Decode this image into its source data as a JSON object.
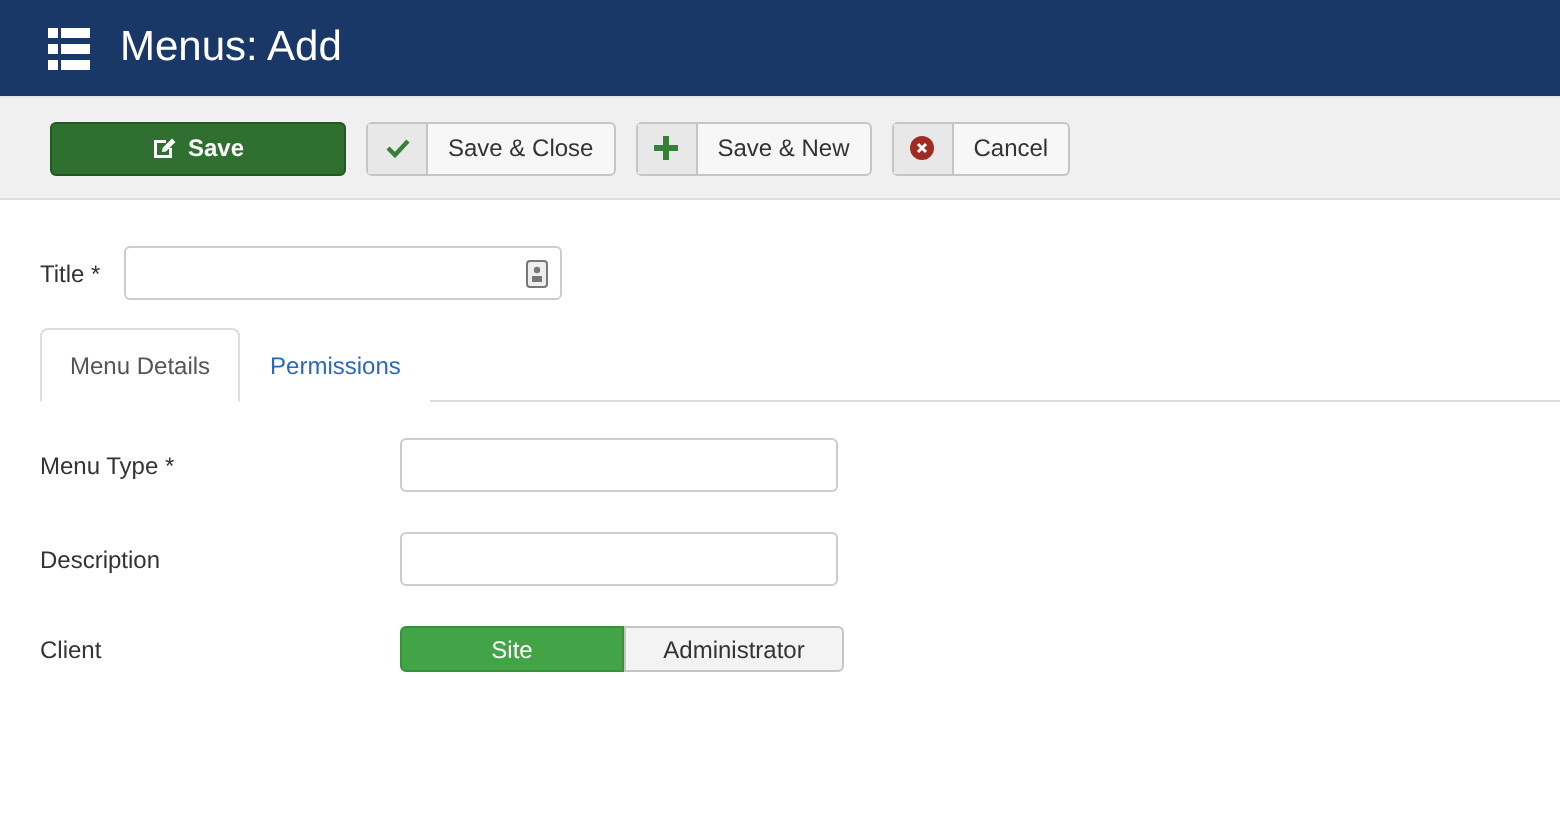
{
  "header": {
    "title": "Menus: Add"
  },
  "toolbar": [
    {
      "label": "Save",
      "kind": "save"
    },
    {
      "label": "Save & Close",
      "kind": "check"
    },
    {
      "label": "Save & New",
      "kind": "new"
    },
    {
      "label": "Cancel",
      "kind": "cancel"
    }
  ],
  "title_field": {
    "label": "Title *"
  },
  "tabs": [
    {
      "label": "Menu Details",
      "selected": true
    },
    {
      "label": "Permissions",
      "selected": false
    }
  ],
  "fields": [
    {
      "label": "Menu Type *",
      "kind": "input"
    },
    {
      "label": "Description",
      "kind": "input"
    },
    {
      "label": "Client",
      "kind": "toggle",
      "options": [
        {
          "label": "Site",
          "selected": true
        },
        {
          "label": "Administrator",
          "selected": false
        }
      ]
    }
  ]
}
